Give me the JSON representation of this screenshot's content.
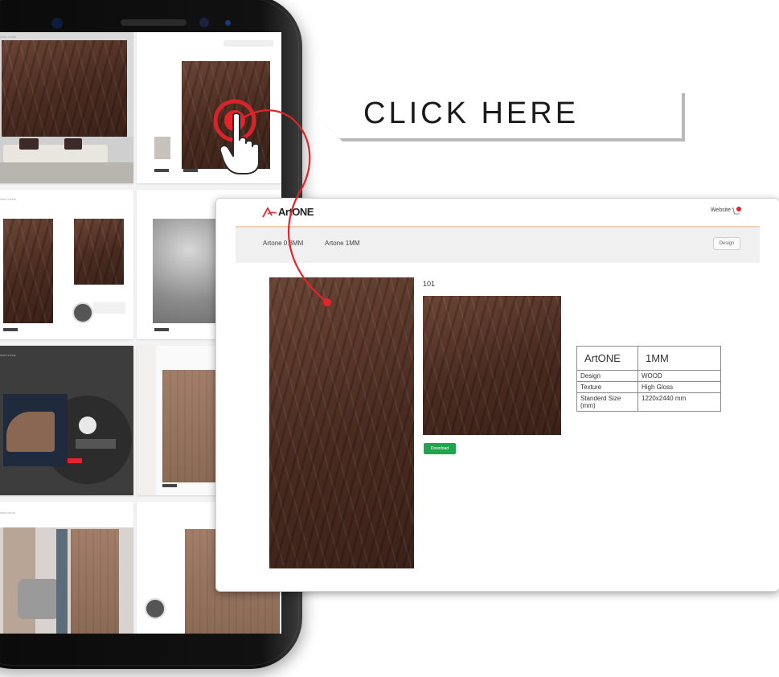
{
  "callout": {
    "text": "CLICK HERE"
  },
  "browser": {
    "logo": "ArtONE",
    "header_link": "Website",
    "cart_count": "0",
    "nav": {
      "items": [
        "Artone 0.8MM",
        "Artone 1MM"
      ],
      "button": "Design"
    },
    "product": {
      "code": "101",
      "green_button": "Download",
      "spec": {
        "brand": "ArtONE",
        "thickness": "1MM",
        "rows": [
          {
            "label": "Design",
            "value": "WOOD"
          },
          {
            "label": "Texture",
            "value": "High Gloss"
          },
          {
            "label": "Standerd Size (mm)",
            "value": "1220x2440 mm"
          }
        ]
      }
    }
  },
  "phone": {
    "page_labels": [
      "SMAS STONE",
      "SMAS STONE",
      "SMAS STONE",
      "SMAS WOOD"
    ]
  },
  "colors": {
    "accent_red": "#e4232b",
    "green": "#1ea64d",
    "wood": "#4a2b20"
  },
  "icons": [
    "hand-pointer-icon",
    "cart-icon",
    "logo-icon"
  ]
}
